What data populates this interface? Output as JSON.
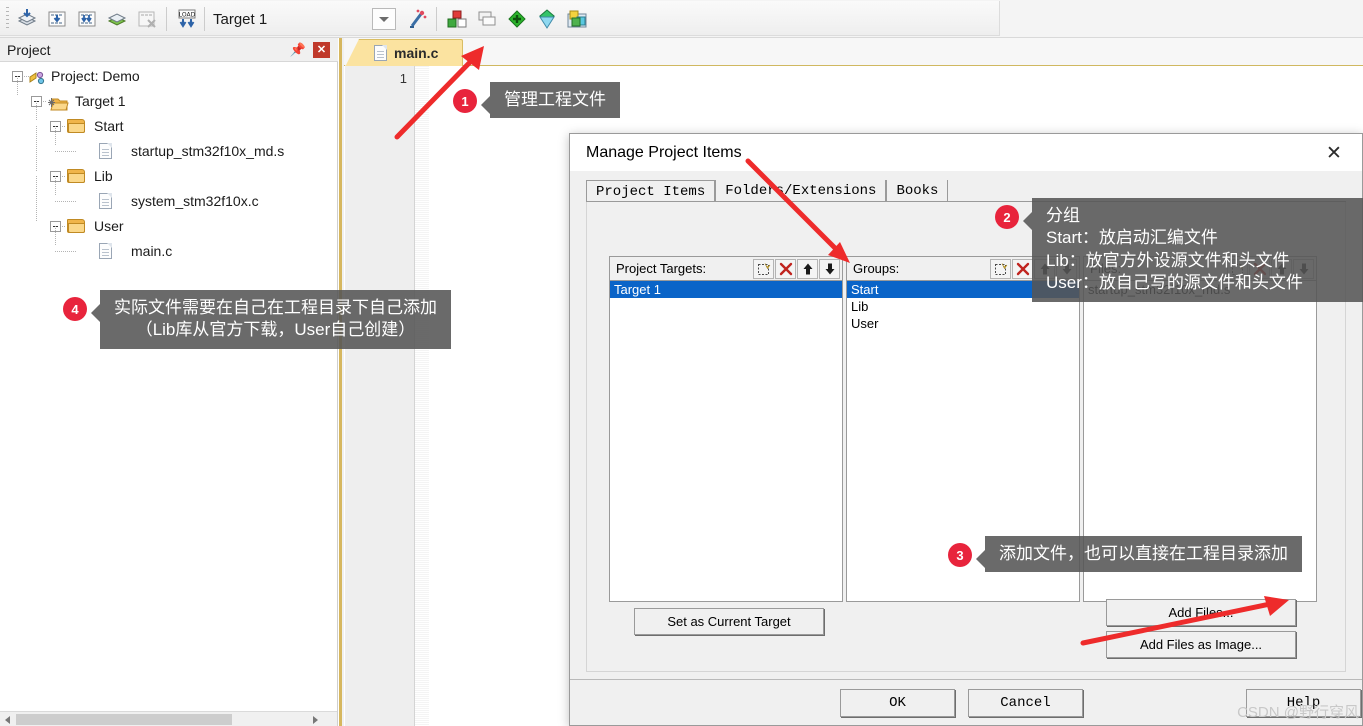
{
  "toolbar": {
    "target_label": "Target 1",
    "icons": [
      "build-target-icon",
      "translate-icon",
      "build-all-icon",
      "batch-build-icon",
      "stop-build-icon",
      "download-to-flash-icon",
      "target-options-dropdown-icon",
      "configuration-wizard-icon",
      "manage-project-items-icon",
      "multi-project-icon",
      "start-debug-icon",
      "insert-watchpoint-icon",
      "packs-icon"
    ]
  },
  "project_panel": {
    "title": "Project",
    "pin_icon": "pin-icon",
    "close_icon": "close-icon",
    "tree": [
      {
        "label": "Project: Demo",
        "type": "project",
        "depth": 0
      },
      {
        "label": "Target 1",
        "type": "target",
        "depth": 1
      },
      {
        "label": "Start",
        "type": "folder",
        "depth": 2
      },
      {
        "label": "startup_stm32f10x_md.s",
        "type": "file",
        "depth": 3
      },
      {
        "label": "Lib",
        "type": "folder",
        "depth": 2
      },
      {
        "label": "system_stm32f10x.c",
        "type": "file",
        "depth": 3
      },
      {
        "label": "User",
        "type": "folder",
        "depth": 2
      },
      {
        "label": "main.c",
        "type": "file",
        "depth": 3
      }
    ]
  },
  "editor": {
    "tab_label": "main.c",
    "line_number": "1"
  },
  "dialog": {
    "title": "Manage Project Items",
    "close_icon": "close-icon",
    "tabs": [
      {
        "label": "Project Items",
        "active": true
      },
      {
        "label": "Folders/Extensions",
        "active": false
      },
      {
        "label": "Books",
        "active": false
      }
    ],
    "project_targets": {
      "label": "Project Targets:",
      "buttons": [
        "new-item-icon",
        "delete-item-icon",
        "move-up-icon",
        "move-down-icon"
      ],
      "items": [
        {
          "label": "Target 1",
          "selected": true
        }
      ]
    },
    "groups": {
      "label": "Groups:",
      "buttons": [
        "new-item-icon",
        "delete-item-icon",
        "move-up-icon",
        "move-down-icon"
      ],
      "items": [
        {
          "label": "Start",
          "selected": true
        },
        {
          "label": "Lib",
          "selected": false
        },
        {
          "label": "User",
          "selected": false
        }
      ]
    },
    "files": {
      "label": "Files:",
      "buttons": [
        "new-item-icon",
        "delete-item-icon",
        "move-up-icon",
        "move-down-icon"
      ],
      "items": [
        {
          "label": "startup_stm32f10x_md.s",
          "selected": false
        }
      ]
    },
    "set_current_target": "Set as Current Target",
    "add_files": "Add Files...",
    "add_files_as_image": "Add Files as Image...",
    "ok": "OK",
    "cancel": "Cancel",
    "help": "Help"
  },
  "callouts": [
    {
      "num": "1",
      "text": "管理工程文件"
    },
    {
      "num": "2",
      "text": "分组\nStart：放启动汇编文件\nLib：放官方外设源文件和头文件\nUser：放自己写的源文件和头文件"
    },
    {
      "num": "3",
      "text": "添加文件，也可以直接在工程目录添加"
    },
    {
      "num": "4",
      "text": "实际文件需要在自己在工程目录下自己添加\n（Lib库从官方下载，User自己创建）"
    }
  ],
  "watermark": "CSDN @野行穿风",
  "colors": {
    "accent_red": "#e8243c",
    "selection_blue": "#0a64c8",
    "tab_yellow": "#fbe3a0",
    "callout_gray": "#555555"
  }
}
